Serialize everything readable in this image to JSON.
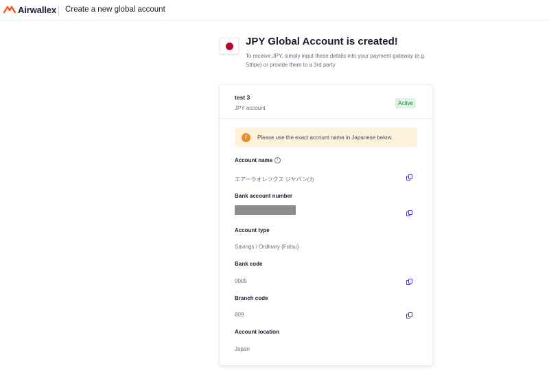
{
  "header": {
    "brand": "Airwallex",
    "page_title": "Create a new global account"
  },
  "success": {
    "flag": "japan-flag",
    "title": "JPY Global Account is created!",
    "description": "To receive JPY, simply input these details into your payment gateway (e.g. Stripe) or provide them to a 3rd party"
  },
  "account": {
    "name": "test 3",
    "subtitle": "JPY account",
    "status": "Active",
    "status_color": "#1f7a3f",
    "notice": "Please use the exact account name in Japanese below.",
    "notice_icon": "!",
    "fields": [
      {
        "label": "Account name",
        "value": "エアーウオレツクス ジヤパン(カ"
      },
      {
        "label": "Bank account number",
        "value": ""
      },
      {
        "label": "Account type",
        "value": "Savings / Ordinary (Futsu)"
      },
      {
        "label": "Bank code",
        "value": "0005"
      },
      {
        "label": "Branch code",
        "value": "809"
      },
      {
        "label": "Account location",
        "value": "Japan"
      }
    ]
  },
  "colors": {
    "accent": "#4a3ec8",
    "brand": "#ff4f1f",
    "notice_bg": "#fdf3dc",
    "warning": "#f08a24"
  }
}
